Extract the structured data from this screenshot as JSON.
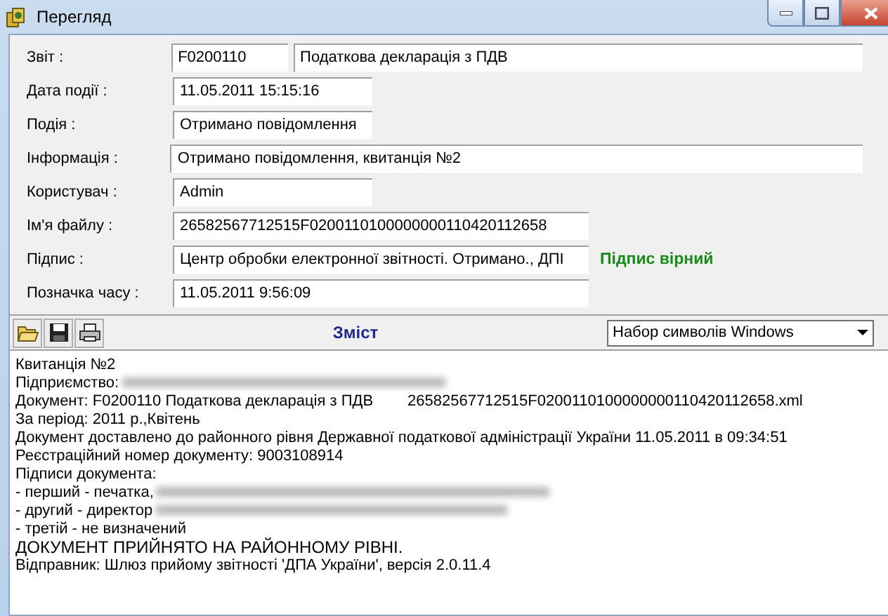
{
  "window": {
    "title": "Перегляд"
  },
  "fields": [
    {
      "label": "Звіт :",
      "kind": "pair",
      "values": [
        "F0200110",
        "Податкова декларація з ПДВ"
      ]
    },
    {
      "label": "Дата події :",
      "kind": "short",
      "values": [
        "11.05.2011 15:15:16"
      ]
    },
    {
      "label": "Подія :",
      "kind": "short",
      "values": [
        "Отримано повідомлення"
      ]
    },
    {
      "label": "Інформація :",
      "kind": "long",
      "values": [
        "Отримано повідомлення, квитанція №2"
      ]
    },
    {
      "label": "Користувач :",
      "kind": "short",
      "values": [
        "Admin"
      ]
    },
    {
      "label": "Ім'я файлу :",
      "kind": "medium",
      "values": [
        "26582567712515F0200110100000000110420112658"
      ]
    },
    {
      "label": "Підпис :",
      "kind": "medium",
      "values": [
        "Центр обробки електронної звітності. Отримано., ДПІ"
      ],
      "status": {
        "text": "Підпис вірний",
        "valid": true
      }
    },
    {
      "label": "Позначка часу :",
      "kind": "medium",
      "values": [
        "11.05.2011 9:56:09"
      ]
    }
  ],
  "toolbar": {
    "title": "Зміст",
    "encoding": "Набор символів Windows"
  },
  "content": [
    {
      "text": "Квитанція №2",
      "redacted": false
    },
    {
      "text": "Підприємство:",
      "redacted": true
    },
    {
      "text": "Документ: F0200110 Податкова декларація з ПДВ        26582567712515F0200110100000000110420112658.xml",
      "redacted": false
    },
    {
      "text": "За період: 2011 р.,Квітень",
      "redacted": false
    },
    {
      "text": "Документ доставлено до районного рівня Державної податкової адміністрації України 11.05.2011 в 09:34:51",
      "redacted": false
    },
    {
      "text": "Реєстраційний номер документу: 9003108914",
      "redacted": false
    },
    {
      "text": "Підписи документа:",
      "redacted": false
    },
    {
      "text": "- перший - печатка,",
      "redacted": true
    },
    {
      "text": "- другий - директор",
      "redacted": true
    },
    {
      "text": "- третій - не визначений",
      "redacted": false
    },
    {
      "text": "ДОКУМЕНТ ПРИЙНЯТО НА РАЙОННОМУ РІВНІ.",
      "redacted": false,
      "emphasis": true
    },
    {
      "text": "Відправник: Шлюз прийому звітності 'ДПА України', версія 2.0.11.4",
      "redacted": false
    }
  ]
}
